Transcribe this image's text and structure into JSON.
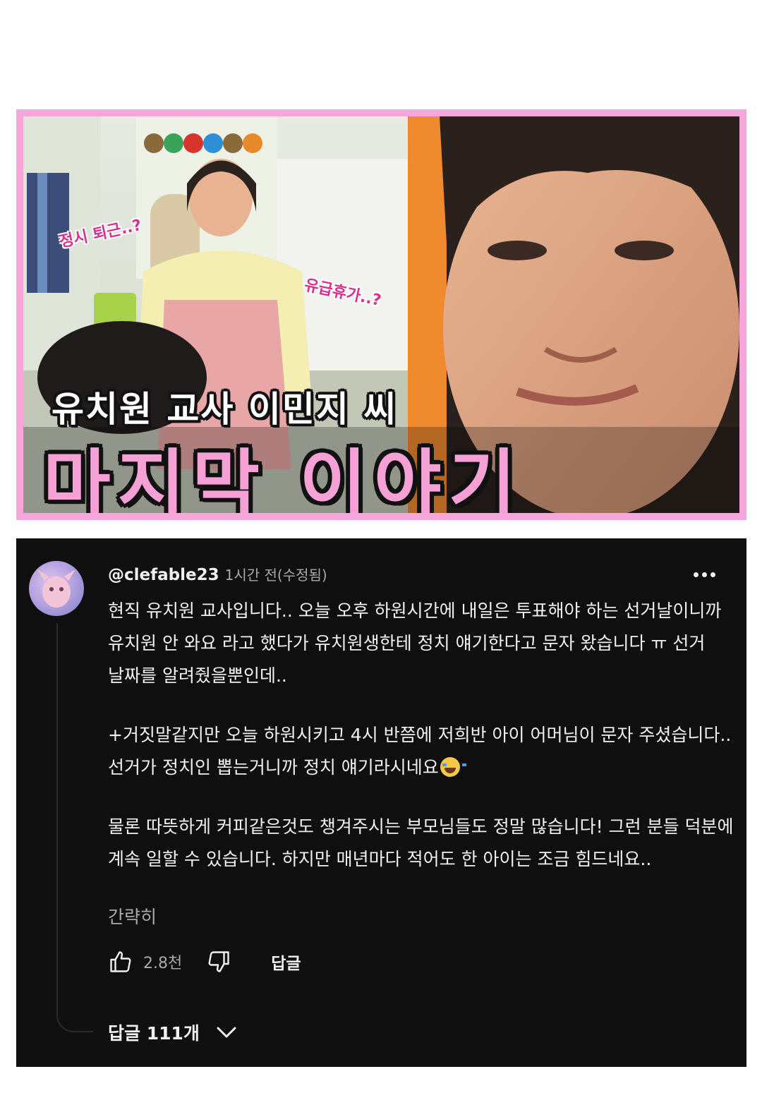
{
  "thumbnail": {
    "caption_small": "유치원 교사 이민지 씨",
    "caption_big": "마지막 이야기",
    "bubble_left": "정시 퇴근..?",
    "bubble_right": "유급휴가..?"
  },
  "comment": {
    "handle": "@clefable23",
    "timestamp": "1시간 전(수정됨)",
    "paragraph_1": "현직 유치원 교사입니다.. 오늘 오후 하원시간에 내일은 투표해야 하는 선거날이니까 유치원 안 와요 라고 했다가 유치원생한테 정치 얘기한다고 문자 왔습니다 ㅠ 선거 날짜를 알려줬을뿐인데..",
    "paragraph_2": "+거짓말같지만 오늘 하원시키고 4시 반쯤에 저희반 아이 어머님이 문자 주셨습니다.. 선거가 정치인 뽑는거니까 정치 얘기라시네요",
    "paragraph_3": "물론 따뜻하게 커피같은것도 챙겨주시는 부모님들도 정말 많습니다! 그런 분들 덕분에 계속 일할 수 있습니다. 하지만 매년마다 적어도 한 아이는 조금 힘드네요..",
    "readmore_label": "간략히",
    "like_count": "2.8천",
    "reply_label": "답글",
    "replies_label": "답글 111개"
  },
  "colors": {
    "frame_pink": "#f7a6dc",
    "panel_bg": "#0f0f0f",
    "text_primary": "#f1f1f1",
    "text_secondary": "#aaaaaa"
  },
  "icons": [
    "more-vert-icon",
    "thumbs-up-icon",
    "thumbs-down-icon",
    "chevron-down-icon",
    "laughing-tears-emoji"
  ]
}
